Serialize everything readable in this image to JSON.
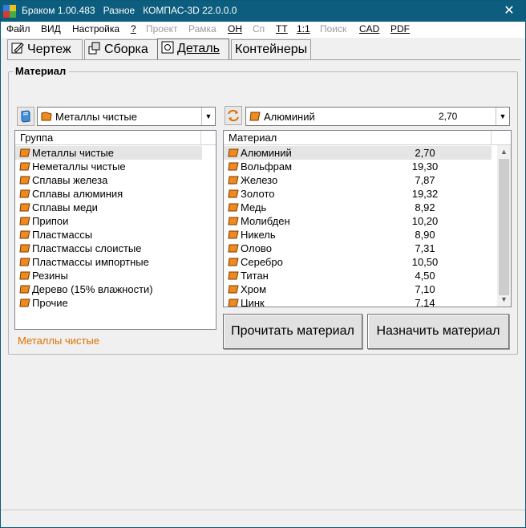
{
  "window": {
    "title": "Браком 1.00.483   Разное   КОМПАС-3D 22.0.0.0",
    "close_glyph": "✕"
  },
  "menu": [
    {
      "label": "Файл",
      "disabled": false
    },
    {
      "label": "ВИД",
      "disabled": false
    },
    {
      "label": "Настройка",
      "disabled": false
    },
    {
      "label": "?",
      "disabled": false
    },
    {
      "label": "Проект",
      "disabled": true
    },
    {
      "label": "Рамка",
      "disabled": true
    },
    {
      "label": "ОН",
      "disabled": false
    },
    {
      "label": "Сп",
      "disabled": true
    },
    {
      "label": "ТТ",
      "disabled": false
    },
    {
      "label": "1:1",
      "disabled": false
    },
    {
      "label": "Поиск",
      "disabled": true
    },
    {
      "label": "CAD",
      "disabled": false
    },
    {
      "label": "PDF",
      "disabled": false
    }
  ],
  "tabs": [
    {
      "label": "Чертеж",
      "icon": "drawing-icon"
    },
    {
      "label": "Сборка",
      "icon": "assembly-icon"
    },
    {
      "label": "Деталь",
      "icon": "part-icon",
      "active": true
    },
    {
      "label": "Контейнеры"
    }
  ],
  "material_group": {
    "title": "Материал",
    "group_combo_value": "Металлы чистые",
    "material_combo_name": "Алюминий",
    "material_combo_value": "2,70",
    "group_list_header": "Группа",
    "material_list_header": "Материал",
    "groups": [
      "Металлы чистые",
      "Неметаллы чистые",
      "Сплавы железа",
      "Сплавы алюминия",
      "Сплавы меди",
      "Припои",
      "Пластмассы",
      "Пластмассы слоистые",
      "Пластмассы импортные",
      "Резины",
      "Дерево (15% влажности)",
      "Прочие"
    ],
    "materials": [
      {
        "name": "Алюминий",
        "density": "2,70"
      },
      {
        "name": "Вольфрам",
        "density": "19,30"
      },
      {
        "name": "Железо",
        "density": "7,87"
      },
      {
        "name": "Золото",
        "density": "19,32"
      },
      {
        "name": "Медь",
        "density": "8,92"
      },
      {
        "name": "Молибден",
        "density": "10,20"
      },
      {
        "name": "Никель",
        "density": "8,90"
      },
      {
        "name": "Олово",
        "density": "7,31"
      },
      {
        "name": "Серебро",
        "density": "10,50"
      },
      {
        "name": "Титан",
        "density": "4,50"
      },
      {
        "name": "Хром",
        "density": "7,10"
      },
      {
        "name": "Цинк",
        "density": "7,14"
      }
    ],
    "selected_group_label": "Металлы чистые",
    "read_button": "Прочитать материал",
    "assign_button": "Назначить материал"
  },
  "colors": {
    "titlebar": "#0c5d7e",
    "material_icon": "#f08a1e",
    "accent_text": "#e07000"
  }
}
